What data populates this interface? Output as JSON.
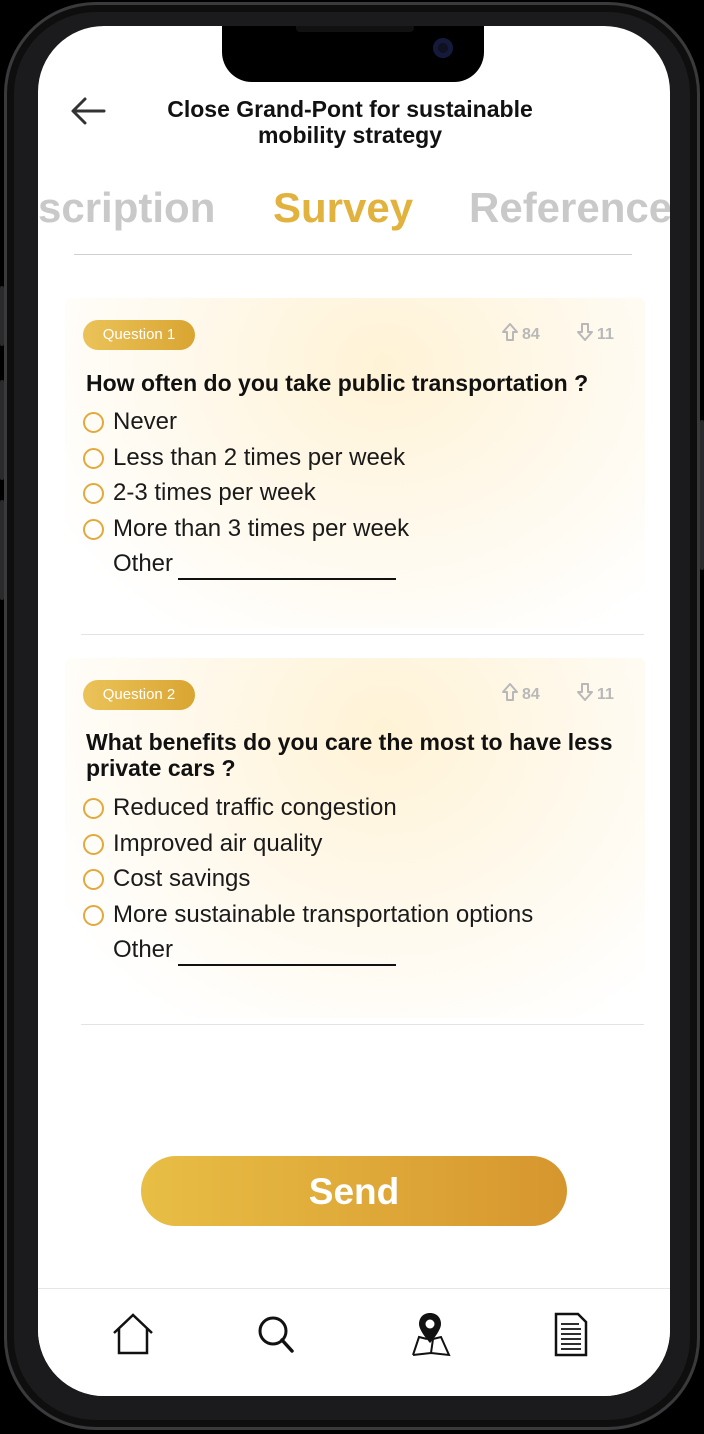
{
  "header": {
    "title": "Close Grand-Pont for sustainable mobility strategy"
  },
  "tabs": [
    {
      "label": "Description",
      "visible_text": "scription"
    },
    {
      "label": "Survey"
    },
    {
      "label": "References",
      "visible_text": "Reference"
    }
  ],
  "active_tab": "Survey",
  "questions": [
    {
      "badge": "Question 1",
      "upvotes": "84",
      "downvotes": "11",
      "text": "How often do you take public transportation ?",
      "options": [
        "Never",
        "Less than 2 times per week",
        "2-3 times per week",
        "More than 3 times per week"
      ],
      "other_label": "Other"
    },
    {
      "badge": "Question 2",
      "upvotes": "84",
      "downvotes": "11",
      "text": "What benefits do you care the most to have less private cars ?",
      "options": [
        "Reduced traffic congestion",
        "Improved air quality",
        "Cost savings",
        "More sustainable transportation options"
      ],
      "other_label": "Other"
    }
  ],
  "send_label": "Send",
  "nav": [
    "home-icon",
    "search-icon",
    "map-pin-icon",
    "document-icon"
  ],
  "colors": {
    "accent": "#e2b23e",
    "accent_dark": "#d6962e",
    "inactive_tab": "#c9c9c9"
  }
}
